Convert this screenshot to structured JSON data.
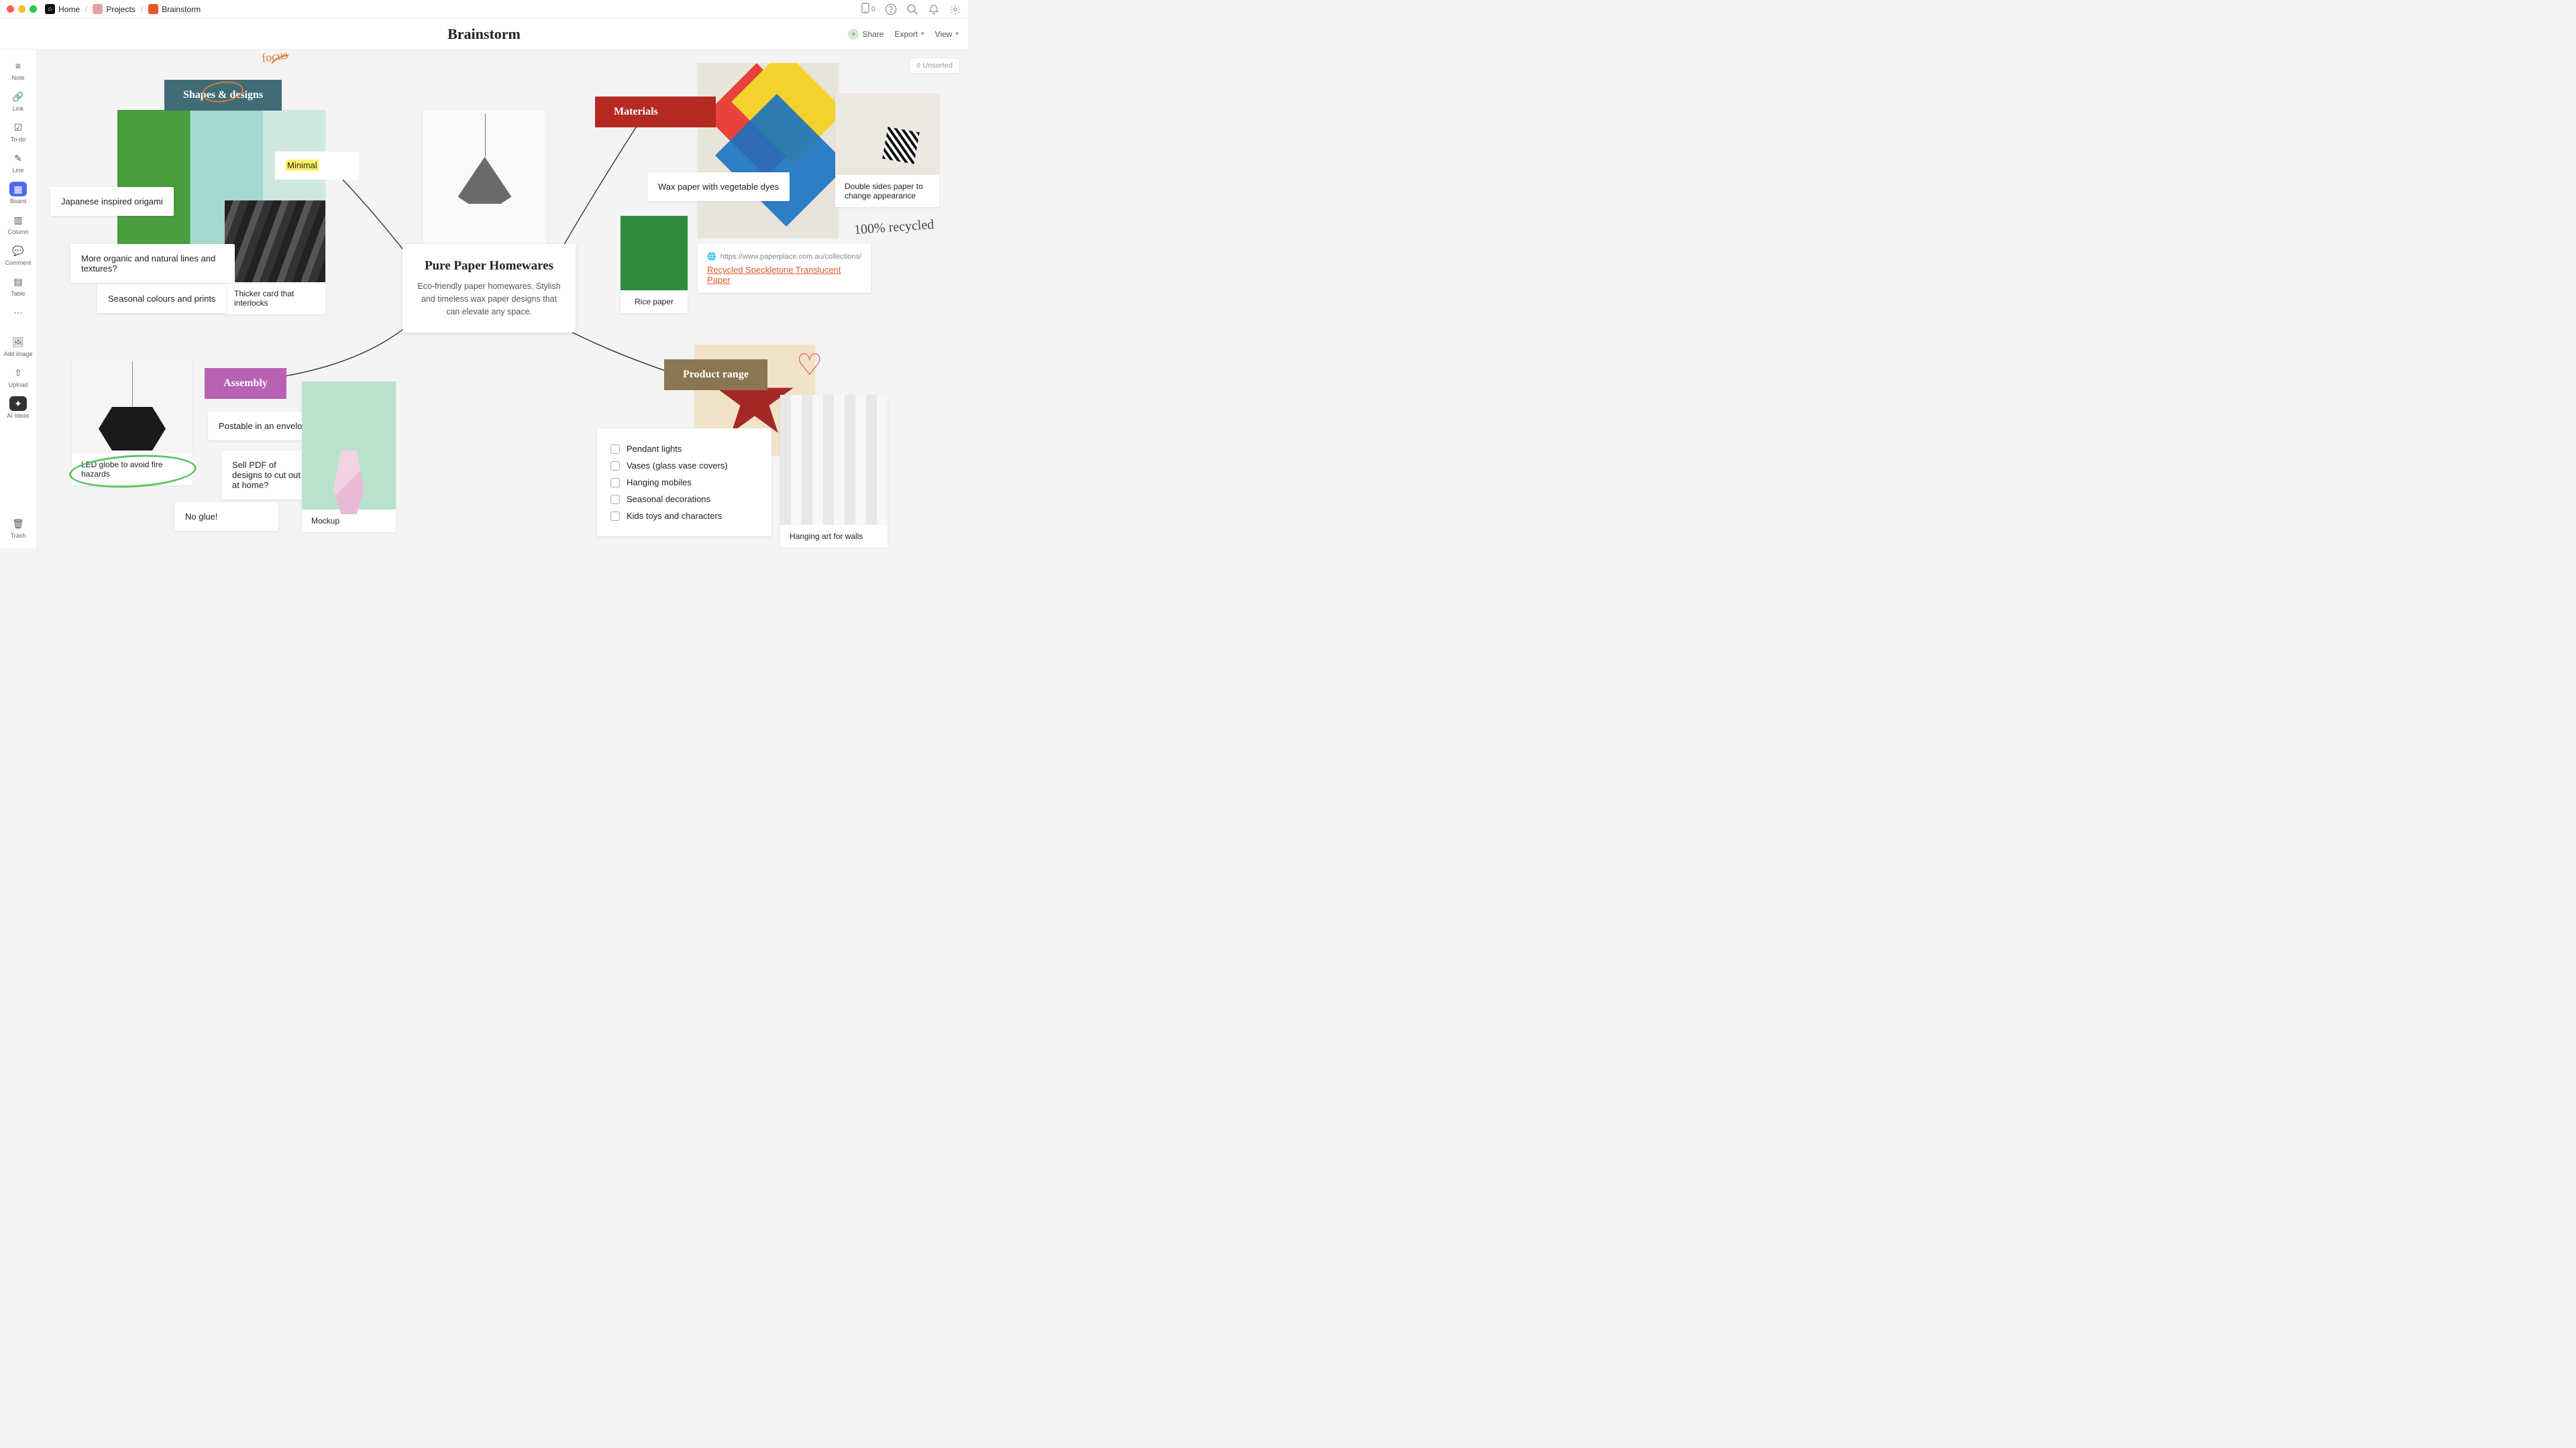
{
  "breadcrumb": {
    "home": "Home",
    "projects": "Projects",
    "brainstorm": "Brainstorm"
  },
  "mobile_count": "0",
  "page_title": "Brainstorm",
  "title_actions": {
    "share": "Share",
    "export": "Export",
    "view": "View"
  },
  "sidebar": {
    "note": "Note",
    "link": "Link",
    "todo": "To-do",
    "line": "Line",
    "board": "Board",
    "column": "Column",
    "comment": "Comment",
    "table": "Table",
    "addimage": "Add image",
    "upload": "Upload",
    "aiideas": "AI Ideas",
    "trash": "Trash"
  },
  "unsorted": {
    "count": "0",
    "label": "Unsorted"
  },
  "labels": {
    "shapes": "Shapes & designs",
    "materials": "Materials",
    "assembly": "Assembly",
    "productrange": "Product range"
  },
  "central": {
    "title": "Pure Paper Homewares",
    "body": "Eco-friendly paper homewares. Stylish and timeless wax paper designs that can elevate any space."
  },
  "notes": {
    "minimal": "Minimal",
    "japanese": "Japanese inspired origami",
    "organic": "More organic and natural lines and textures?",
    "seasonal": "Seasonal colours and prints",
    "thicker": "Thicker card that interlocks",
    "led": "LED globe to avoid fire hazards",
    "postable": "Postable in an envelope",
    "sellpdf": "Sell PDF of designs to cut out at home?",
    "noglue": "No glue!",
    "mockup": "Mockup",
    "wax": "Wax paper with vegetable dyes",
    "rice": "Rice paper",
    "double": "Double sides paper to change appearance",
    "hanging": "Hanging art for walls"
  },
  "linkcard": {
    "url": "https://www.paperplace.com.au/collections/re",
    "title": "Recycled Speckletone Translucent Paper"
  },
  "checklist": [
    "Pendant lights",
    "Vases (glass vase covers)",
    "Hanging mobiles",
    "Seasonal decorations",
    "Kids toys and characters"
  ],
  "handwriting": {
    "focus": "focus",
    "recycled": "100% recycled"
  }
}
